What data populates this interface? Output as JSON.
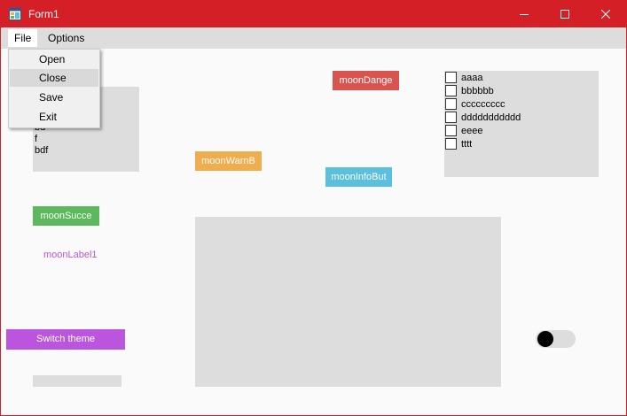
{
  "window": {
    "title": "Form1",
    "accent": "#d41f27"
  },
  "menubar": {
    "items": [
      {
        "label": "File"
      },
      {
        "label": "Options"
      }
    ]
  },
  "file_menu": {
    "items": [
      {
        "label": "Open"
      },
      {
        "label": "Close"
      },
      {
        "label": "Save"
      },
      {
        "label": "Exit"
      }
    ]
  },
  "listbox": {
    "items": [
      "d",
      "bd",
      "f",
      "bdf"
    ]
  },
  "buttons": {
    "danger": {
      "label": "moonDange",
      "color": "#d9534f"
    },
    "warning": {
      "label": "moonWarnB",
      "color": "#f0ad4e"
    },
    "info": {
      "label": "moonInfoBut",
      "color": "#5bc0de"
    },
    "success": {
      "label": "moonSucce",
      "color": "#5cb85c"
    },
    "switch_theme": {
      "label": "Switch theme",
      "color": "#bb55dd"
    }
  },
  "label1": {
    "text": "moonLabel1",
    "color": "#bb55dd"
  },
  "checklist": {
    "items": [
      {
        "label": "aaaa",
        "checked": false
      },
      {
        "label": "bbbbbb",
        "checked": false
      },
      {
        "label": "ccccccccc",
        "checked": false
      },
      {
        "label": "ddddddddddd",
        "checked": false
      },
      {
        "label": "eeee",
        "checked": false
      },
      {
        "label": "tttt",
        "checked": false
      }
    ]
  },
  "toggle": {
    "on": false
  },
  "progress": {
    "value": 0
  }
}
